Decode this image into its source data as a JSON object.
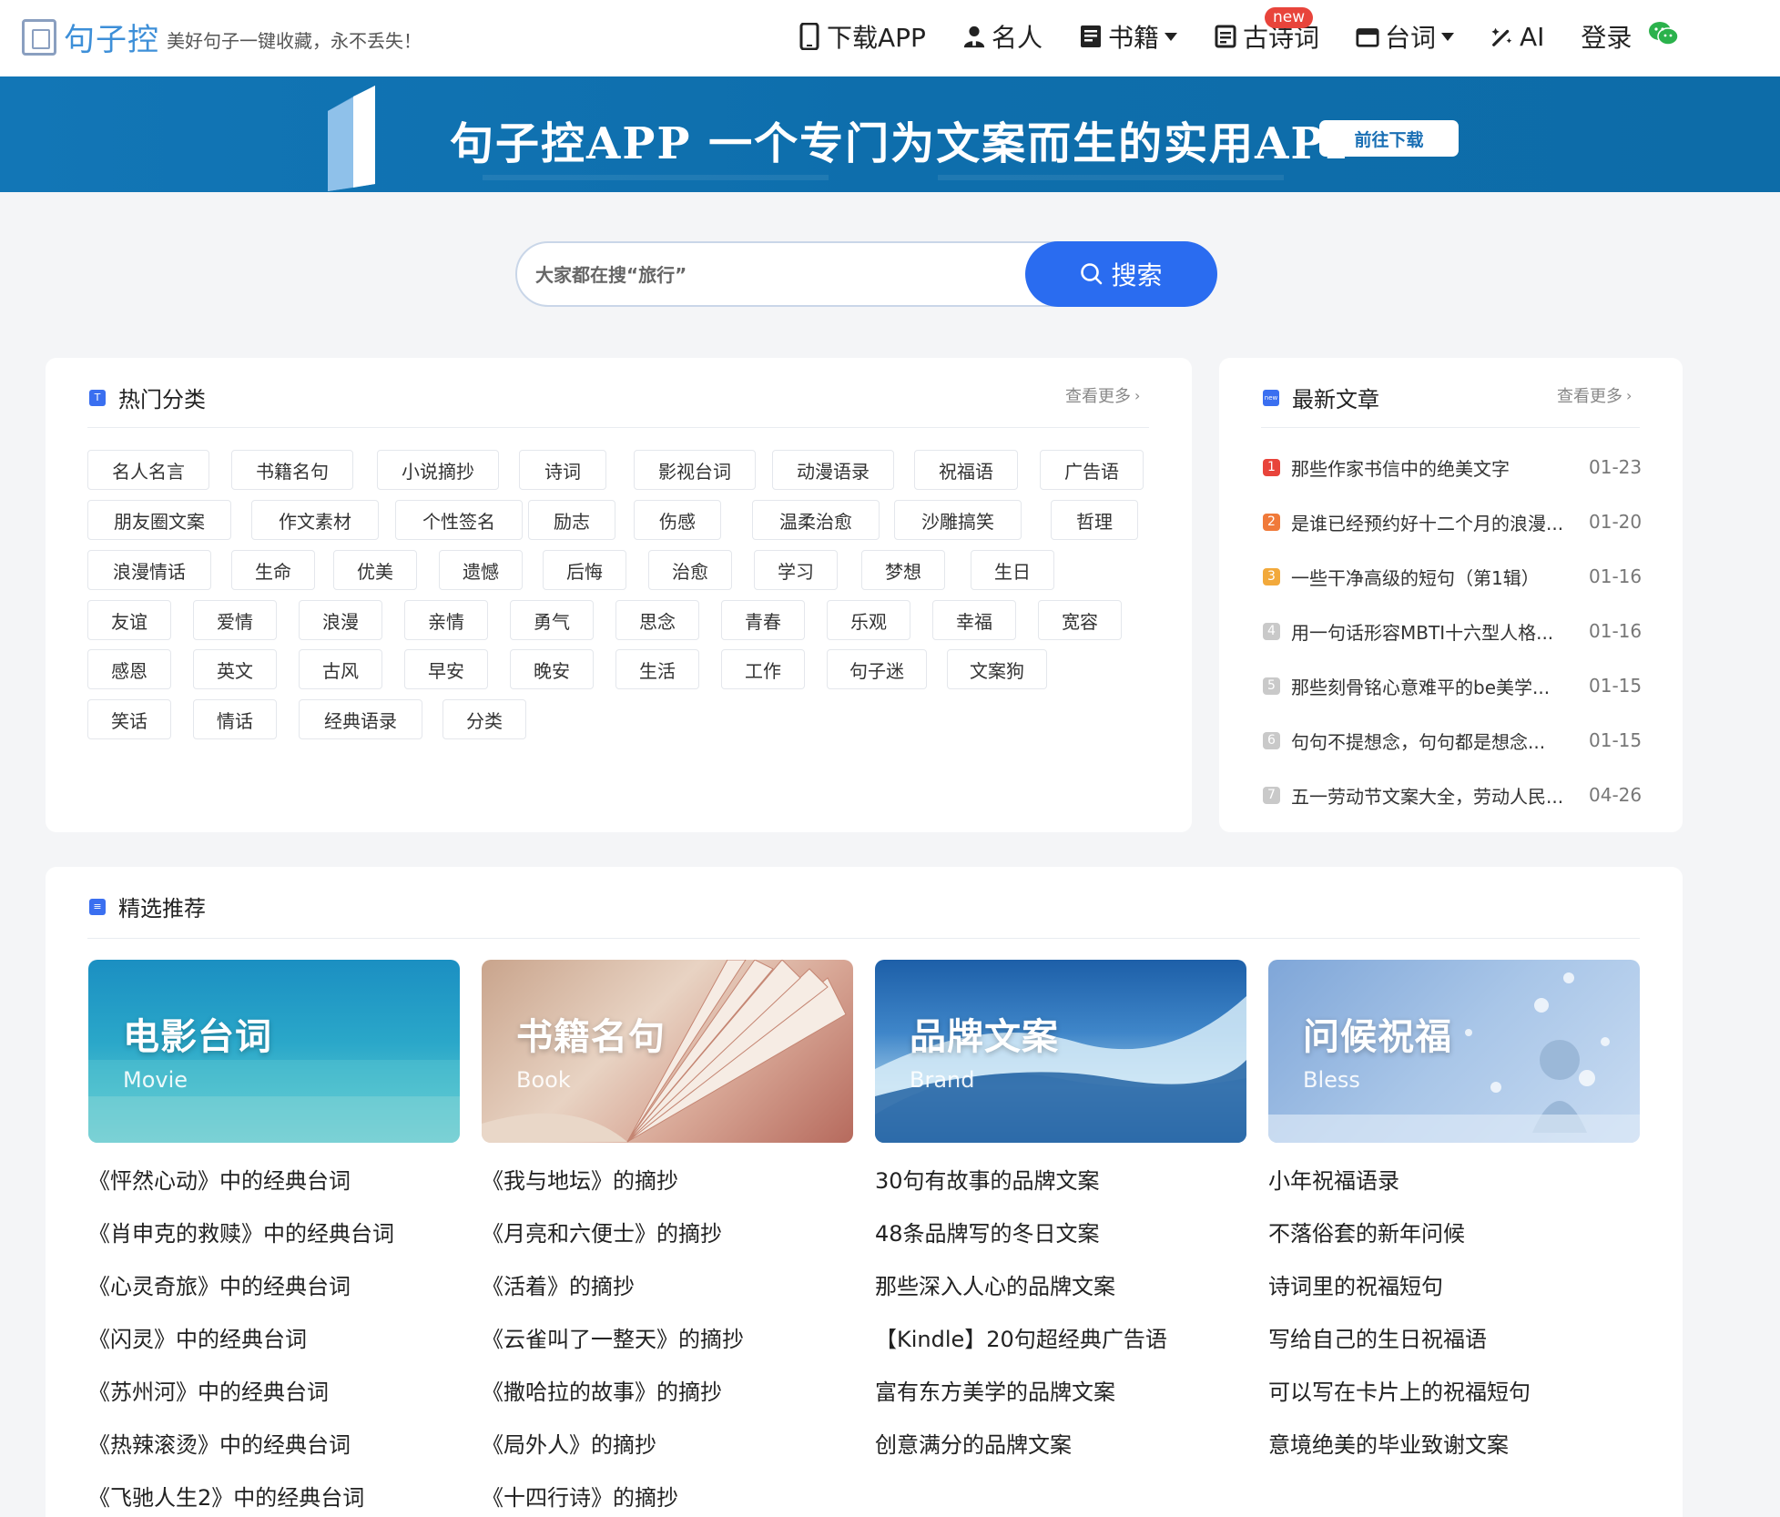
{
  "header": {
    "logo_text": "句子控",
    "slogan": "美好句子一键收藏，永不丢失！",
    "nav": [
      {
        "label": "下载APP",
        "icon": "phone-icon"
      },
      {
        "label": "名人",
        "icon": "person-icon"
      },
      {
        "label": "书籍",
        "icon": "book-icon",
        "dropdown": true
      },
      {
        "label": "古诗词",
        "icon": "poem-icon",
        "badge": "new"
      },
      {
        "label": "台词",
        "icon": "clapper-icon",
        "dropdown": true
      },
      {
        "label": "AI",
        "icon": "magic-wand-icon"
      },
      {
        "label": "登录"
      }
    ],
    "wechat_icon": "wechat-icon"
  },
  "banner": {
    "title": "句子控APP 一个专门为文案而生的实用APP",
    "button": "前往下载"
  },
  "search": {
    "placeholder": "大家都在搜“旅行”",
    "button": "搜索"
  },
  "hot_categories": {
    "title": "热门分类",
    "more": "查看更多",
    "tags": [
      [
        "名人名言",
        "书籍名句",
        "小说摘抄",
        "诗词",
        "影视台词",
        "动漫语录",
        "祝福语",
        "广告语"
      ],
      [
        "朋友圈文案",
        "作文素材",
        "个性签名",
        "励志",
        "伤感",
        "温柔治愈",
        "沙雕搞笑",
        "哲理"
      ],
      [
        "浪漫情话",
        "生命",
        "优美",
        "遗憾",
        "后悔",
        "治愈",
        "学习",
        "梦想",
        "生日"
      ],
      [
        "友谊",
        "爱情",
        "浪漫",
        "亲情",
        "勇气",
        "思念",
        "青春",
        "乐观",
        "幸福",
        "宽容"
      ],
      [
        "感恩",
        "英文",
        "古风",
        "早安",
        "晚安",
        "生活",
        "工作",
        "句子迷",
        "文案狗"
      ],
      [
        "笑话",
        "情话",
        "经典语录",
        "分类"
      ]
    ]
  },
  "latest": {
    "title": "最新文章",
    "more": "查看更多",
    "articles": [
      {
        "rank": "1",
        "title": "那些作家书信中的绝美文字",
        "date": "01-23"
      },
      {
        "rank": "2",
        "title": "是谁已经预约好十二个月的浪漫...",
        "date": "01-20"
      },
      {
        "rank": "3",
        "title": "一些干净高级的短句（第1辑）",
        "date": "01-16"
      },
      {
        "rank": "4",
        "title": "用一句话形容MBTI十六型人格...",
        "date": "01-16"
      },
      {
        "rank": "5",
        "title": "那些刻骨铭心意难平的be美学...",
        "date": "01-15"
      },
      {
        "rank": "6",
        "title": "句句不提想念，句句都是想念...",
        "date": "01-15"
      },
      {
        "rank": "7",
        "title": "五一劳动节文案大全，劳动人民...",
        "date": "04-26"
      }
    ],
    "rank_colors": [
      "#e8443b",
      "#f07a3a",
      "#f2a93b",
      "#c9c9c9",
      "#c9c9c9",
      "#c9c9c9",
      "#c9c9c9"
    ]
  },
  "featured": {
    "title": "精选推荐",
    "columns": [
      {
        "title": "电影台词",
        "sub": "Movie",
        "links": [
          "《怦然心动》中的经典台词",
          "《肖申克的救赎》中的经典台词",
          "《心灵奇旅》中的经典台词",
          "《闪灵》中的经典台词",
          "《苏州河》中的经典台词",
          "《热辣滚烫》中的经典台词",
          "《飞驰人生2》中的经典台词"
        ]
      },
      {
        "title": "书籍名句",
        "sub": "Book",
        "links": [
          "《我与地坛》的摘抄",
          "《月亮和六便士》的摘抄",
          "《活着》的摘抄",
          "《云雀叫了一整天》的摘抄",
          "《撒哈拉的故事》的摘抄",
          "《局外人》的摘抄",
          "《十四行诗》的摘抄"
        ]
      },
      {
        "title": "品牌文案",
        "sub": "Brand",
        "links": [
          "30句有故事的品牌文案",
          "48条品牌写的冬日文案",
          "那些深入人心的品牌文案",
          "【Kindle】20句超经典广告语",
          "富有东方美学的品牌文案",
          "创意满分的品牌文案"
        ]
      },
      {
        "title": "问候祝福",
        "sub": "Bless",
        "links": [
          "小年祝福语录",
          "不落俗套的新年问候",
          "诗词里的祝福短句",
          "写给自己的生日祝福语",
          "可以写在卡片上的祝福短句",
          "意境绝美的毕业致谢文案"
        ]
      }
    ]
  },
  "colors": {
    "accent": "#2a6cf0",
    "banner": "#1276b6",
    "logo": "#3d8fd8"
  }
}
